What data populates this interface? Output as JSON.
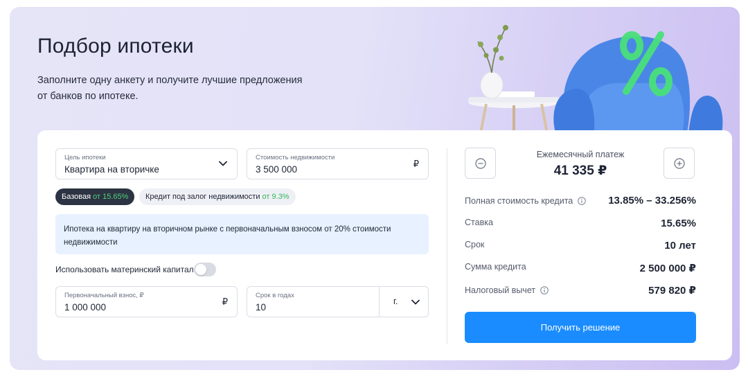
{
  "header": {
    "title": "Подбор ипотеки",
    "subtitle_line1": "Заполните одну анкету и получите лучшие предложения",
    "subtitle_line2": "от банков по ипотеке."
  },
  "form": {
    "purpose": {
      "label": "Цель ипотеки",
      "value": "Квартира на вторичке"
    },
    "property_cost": {
      "label": "Стоимость недвижимости",
      "value": "3 500 000",
      "currency": "₽"
    },
    "chips": [
      {
        "label": "Базовая",
        "rate": "от 15.65%",
        "active": true
      },
      {
        "label": "Кредит под залог недвижимости",
        "rate": "от 9.3%",
        "active": false
      }
    ],
    "info_text": "Ипотека на квартиру на вторичном рынке с первоначальным взносом от 20% стоимости недвижимости",
    "maternity_capital": {
      "label": "Использовать материнский капитал",
      "enabled": false
    },
    "down_payment": {
      "label": "Первоначальный взнос, ₽",
      "value": "1 000 000",
      "currency": "₽"
    },
    "term": {
      "label": "Срок в годах",
      "value": "10",
      "unit": "г."
    }
  },
  "summary": {
    "monthly_label": "Ежемесячный платеж",
    "monthly_value": "41 335 ₽",
    "rows": [
      {
        "label": "Полная стоимость кредита",
        "value": "13.85% – 33.256%",
        "info": true
      },
      {
        "label": "Ставка",
        "value": "15.65%",
        "info": false
      },
      {
        "label": "Срок",
        "value": "10 лет",
        "info": false
      },
      {
        "label": "Сумма кредита",
        "value": "2 500 000 ₽",
        "info": false
      },
      {
        "label": "Налоговый вычет",
        "value": "579 820 ₽",
        "info": true
      }
    ],
    "cta_label": "Получить решение"
  },
  "colors": {
    "accent": "#1a8cff",
    "chip_active_bg": "#2c3342",
    "rate_green": "#34b65a",
    "info_bg": "#e7f1ff"
  },
  "icons": [
    "chevron-down-icon",
    "minus-circle-icon",
    "plus-circle-icon",
    "info-icon"
  ]
}
